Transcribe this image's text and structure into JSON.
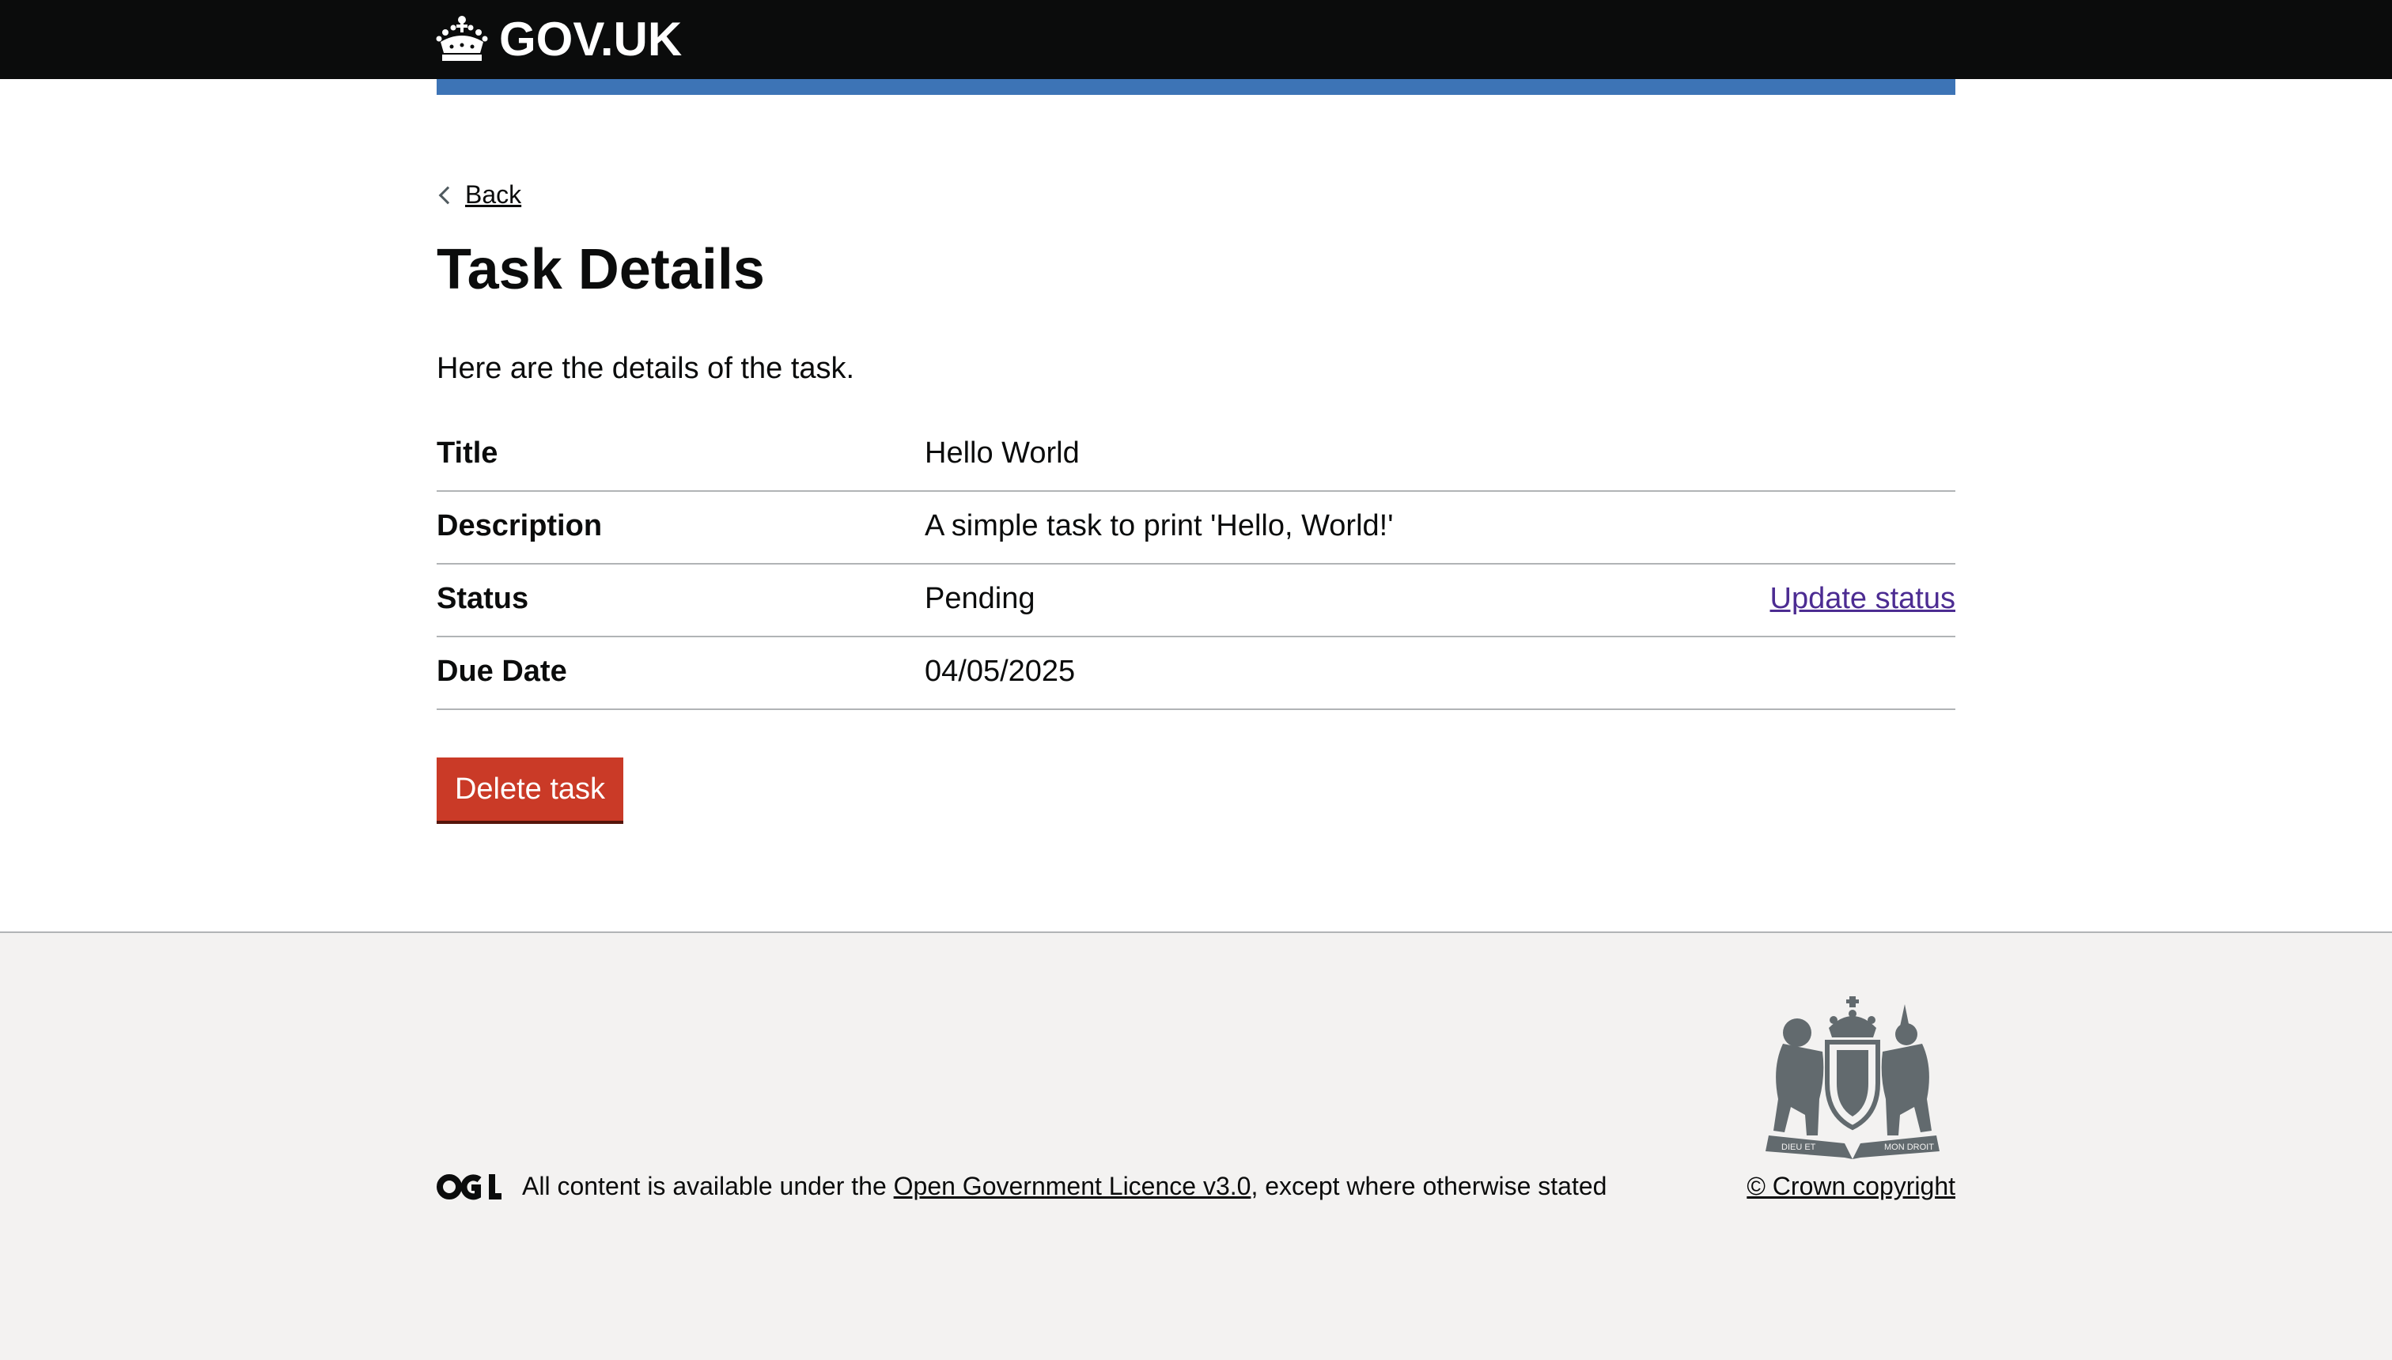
{
  "header": {
    "logo_text": "GOV.UK",
    "logo_icon": "crown-icon"
  },
  "colors": {
    "header_bg": "#0b0c0c",
    "blue_bar": "#3d74b6",
    "delete_button": "#ca3a27",
    "link_visited": "#4c2c92",
    "footer_bg": "#f3f2f1"
  },
  "main": {
    "back_label": "Back",
    "title": "Task Details",
    "lead": "Here are the details of the task.",
    "summary": [
      {
        "key": "Title",
        "value": "Hello World",
        "action": ""
      },
      {
        "key": "Description",
        "value": "A simple task to print 'Hello, World!'",
        "action": ""
      },
      {
        "key": "Status",
        "value": "Pending",
        "action": "Update status"
      },
      {
        "key": "Due Date",
        "value": "04/05/2025",
        "action": ""
      }
    ],
    "delete_label": "Delete task"
  },
  "footer": {
    "licence_prefix": "All content is available under the ",
    "licence_link": "Open Government Licence v3.0",
    "licence_suffix": ", except where otherwise stated",
    "copyright": "© Crown copyright",
    "ogl_icon": "ogl-logo-icon",
    "crest_icon": "royal-coat-of-arms-icon",
    "crest_motto_left": "DIEU ET",
    "crest_motto_right": "MON DROIT"
  }
}
